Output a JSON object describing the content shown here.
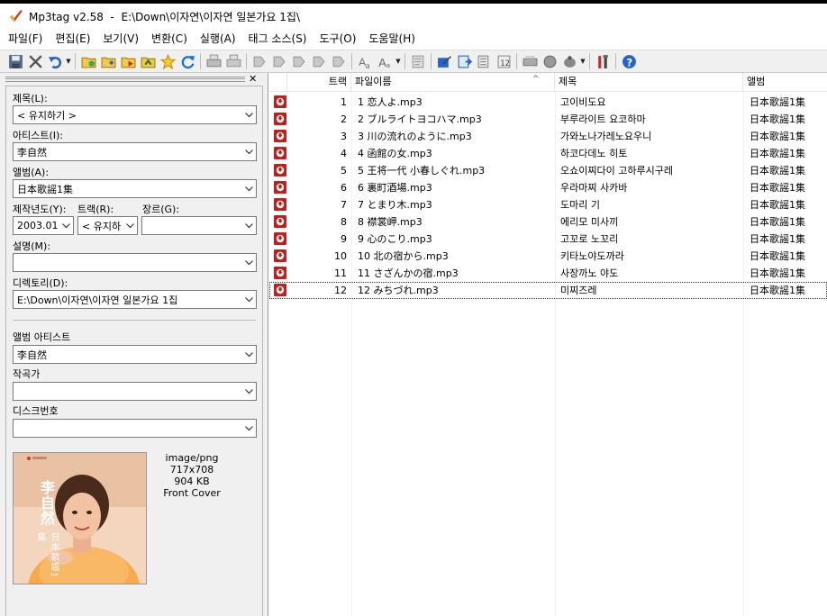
{
  "window": {
    "title": "Mp3tag v2.58  -  E:\\Down\\이자연\\이자연 일본가요 1집\\"
  },
  "menu": [
    {
      "label": "파일(F)"
    },
    {
      "label": "편집(E)"
    },
    {
      "label": "보기(V)"
    },
    {
      "label": "변환(C)"
    },
    {
      "label": "실행(A)"
    },
    {
      "label": "태그 소스(S)"
    },
    {
      "label": "도구(O)"
    },
    {
      "label": "도움말(H)"
    }
  ],
  "toolbar_icons": [
    "save-icon",
    "remove-tag-icon",
    "undo-icon",
    "add-directory-icon",
    "change-directory-icon",
    "open-folder-icon",
    "favorites-icon",
    "refresh-icon",
    "tag-to-filename-icon",
    "filename-to-tag-icon",
    "export-icon",
    "help-icon"
  ],
  "fields": {
    "title": {
      "label": "제목(L):",
      "value": "< 유지하기 >"
    },
    "artist": {
      "label": "아티스트(I):",
      "value": "李自然"
    },
    "album": {
      "label": "앨범(A):",
      "value": "日本歌謡1集"
    },
    "year": {
      "label": "제작년도(Y):",
      "value": "2003.01."
    },
    "track": {
      "label": "트랙(R):",
      "value": "< 유지하"
    },
    "genre": {
      "label": "장르(G):",
      "value": ""
    },
    "comment": {
      "label": "설명(M):",
      "value": ""
    },
    "directory": {
      "label": "디렉토리(D):",
      "value": "E:\\Down\\이자연\\이자연 일본가요 1집"
    },
    "album_artist": {
      "label": "앨범 아티스트",
      "value": "李自然"
    },
    "composer": {
      "label": "작곡가",
      "value": ""
    },
    "disc": {
      "label": "디스크번호",
      "value": ""
    }
  },
  "cover": {
    "format": "image/png",
    "dimensions": "717x708",
    "size": "904 KB",
    "type": "Front Cover",
    "art_name": "李自然",
    "art_sub": "日本歌謡1集"
  },
  "columns": {
    "track": "트랙",
    "filename": "파일이름",
    "title": "제목",
    "album": "앨범"
  },
  "rows": [
    {
      "track": "1",
      "filename": "1 恋人よ.mp3",
      "title": "고이비도요",
      "album": "日本歌謡1集"
    },
    {
      "track": "2",
      "filename": "2 ブルライトヨコハマ.mp3",
      "title": "부루라이트 요코하마",
      "album": "日本歌謡1集"
    },
    {
      "track": "3",
      "filename": "3 川の流れのように.mp3",
      "title": "가와노나가레노요우니",
      "album": "日本歌謡1集"
    },
    {
      "track": "4",
      "filename": "4 函館の女.mp3",
      "title": "하코다데노 히토",
      "album": "日本歌謡1集"
    },
    {
      "track": "5",
      "filename": "5 王将一代 小春しぐれ.mp3",
      "title": "오쇼이찌다이 고하루시구레",
      "album": "日本歌謡1集"
    },
    {
      "track": "6",
      "filename": "6 裏町酒場.mp3",
      "title": "우라마찌 사카바",
      "album": "日本歌謡1集"
    },
    {
      "track": "7",
      "filename": "7 とまり木.mp3",
      "title": "도마리 기",
      "album": "日本歌謡1集"
    },
    {
      "track": "8",
      "filename": "8 襟裳岬.mp3",
      "title": "에리모 미사끼",
      "album": "日本歌謡1集"
    },
    {
      "track": "9",
      "filename": "9 心のこり.mp3",
      "title": "고꼬로 노꼬리",
      "album": "日本歌謡1集"
    },
    {
      "track": "10",
      "filename": "10 北の宿から.mp3",
      "title": "키타노야도까라",
      "album": "日本歌謡1集"
    },
    {
      "track": "11",
      "filename": "11 さざんかの宿.mp3",
      "title": "사장까노 야도",
      "album": "日本歌謡1集"
    },
    {
      "track": "12",
      "filename": "12 みちづれ.mp3",
      "title": "미찌즈레",
      "album": "日本歌謡1集"
    }
  ],
  "colors": {
    "file_icon_red": "#c0201c",
    "accent_blue": "#2563c9"
  }
}
